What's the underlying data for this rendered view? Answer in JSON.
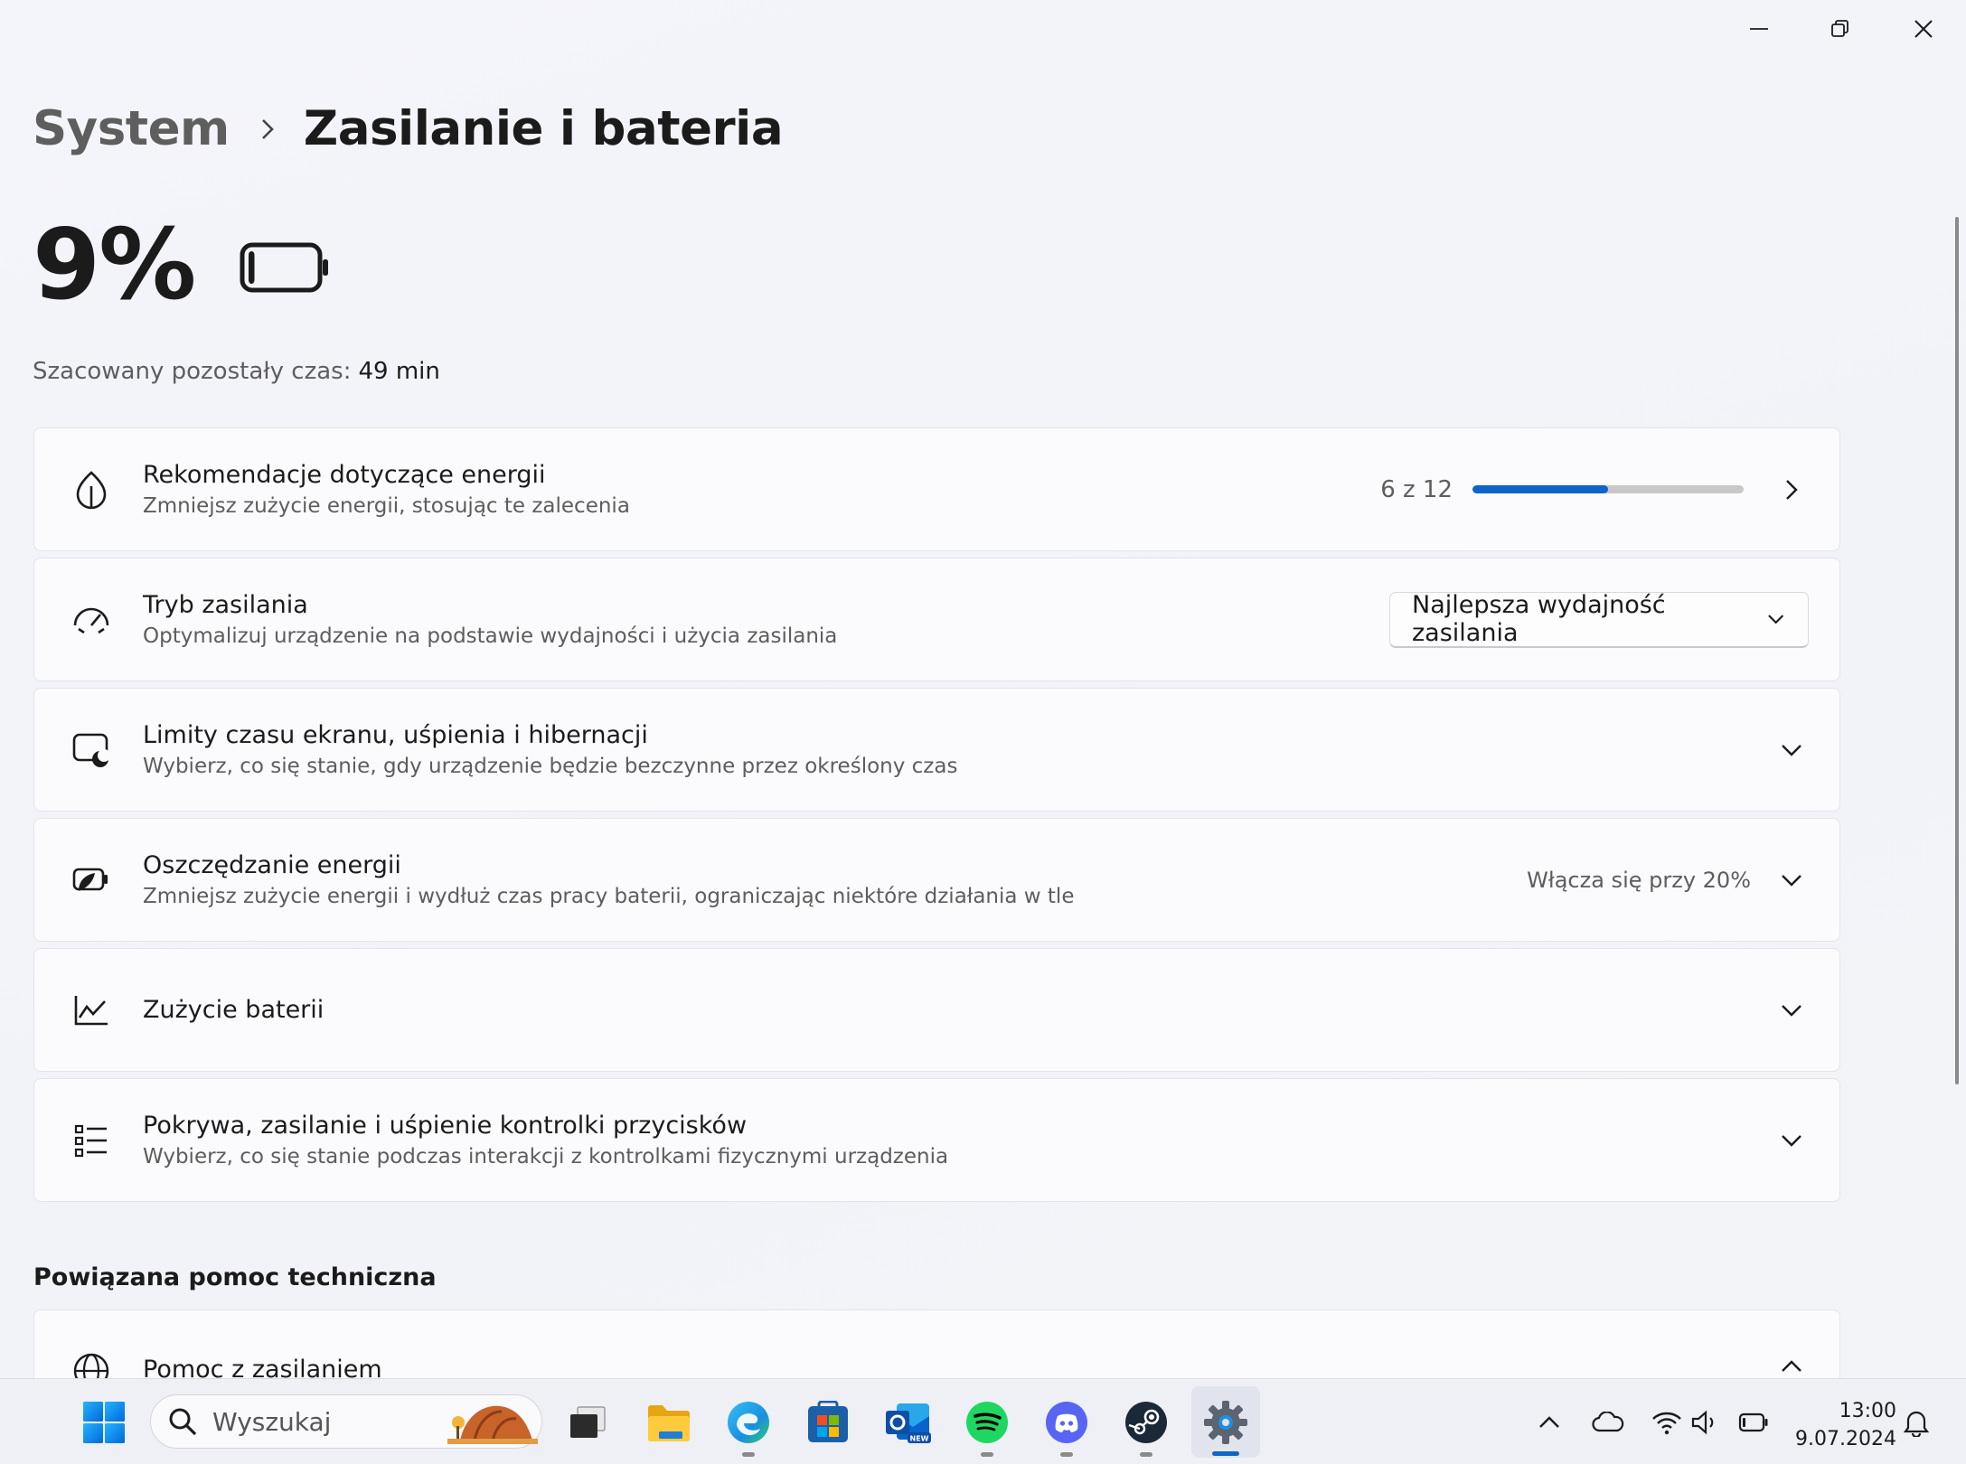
{
  "breadcrumb": {
    "root": "System",
    "current": "Zasilanie i bateria"
  },
  "battery": {
    "percent": "9%",
    "level": 0.09,
    "estimate_label": "Szacowany pozostały czas:",
    "estimate_value": "49 min"
  },
  "cards": {
    "recommendations": {
      "title": "Rekomendacje dotyczące energii",
      "subtitle": "Zmniejsz zużycie energii, stosując te zalecenia",
      "progress_text": "6 z 12",
      "progress_done": 6,
      "progress_total": 12
    },
    "power_mode": {
      "title": "Tryb zasilania",
      "subtitle": "Optymalizuj urządzenie na podstawie wydajności i użycia zasilania",
      "selected": "Najlepsza wydajność zasilania"
    },
    "screen_sleep": {
      "title": "Limity czasu ekranu, uśpienia i hibernacji",
      "subtitle": "Wybierz, co się stanie, gdy urządzenie będzie bezczynne przez określony czas"
    },
    "energy_saver": {
      "title": "Oszczędzanie energii",
      "subtitle": "Zmniejsz zużycie energii i wydłuż czas pracy baterii, ograniczając niektóre działania w tle",
      "status": "Włącza się przy 20%"
    },
    "battery_usage": {
      "title": "Zużycie baterii"
    },
    "lid_buttons": {
      "title": "Pokrywa, zasilanie i uśpienie kontrolki przycisków",
      "subtitle": "Wybierz, co się stanie podczas interakcji z kontrolkami fizycznymi urządzenia"
    }
  },
  "related": {
    "section_title": "Powiązana pomoc techniczna",
    "help_item": "Pomoc z zasilaniem"
  },
  "taskbar": {
    "search_placeholder": "Wyszukaj",
    "time": "13:00",
    "date": "9.07.2024"
  },
  "colors": {
    "accent": "#0f64c8",
    "spotify": "#1ed760",
    "discord": "#5865f2",
    "steam": "#1b2838"
  }
}
